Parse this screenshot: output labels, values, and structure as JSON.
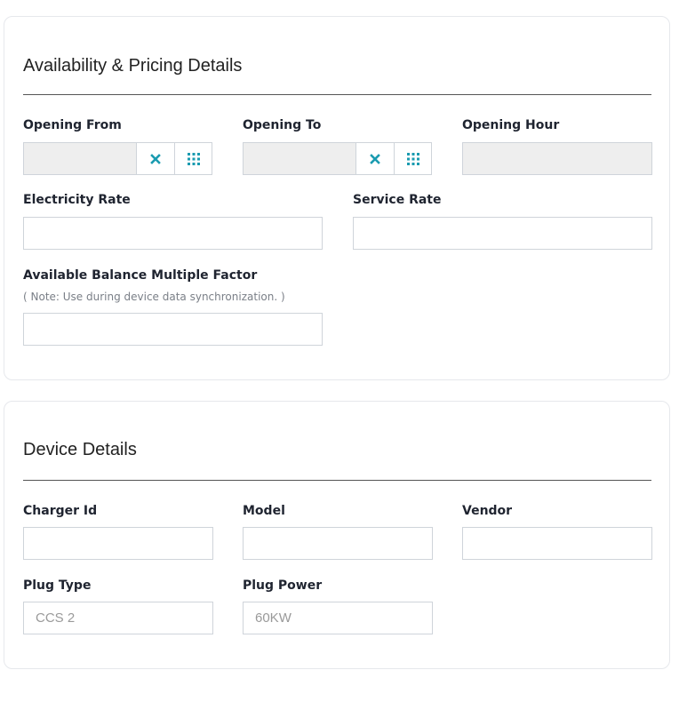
{
  "availability": {
    "title": "Availability & Pricing Details",
    "opening_from": {
      "label": "Opening From"
    },
    "opening_to": {
      "label": "Opening To"
    },
    "opening_hour": {
      "label": "Opening Hour"
    },
    "electricity_rate": {
      "label": "Electricity Rate"
    },
    "service_rate": {
      "label": "Service Rate"
    },
    "balance_factor": {
      "label": "Available Balance Multiple Factor",
      "note": "( Note: Use during device data synchronization. )"
    }
  },
  "device": {
    "title": "Device Details",
    "charger_id": {
      "label": "Charger Id"
    },
    "model": {
      "label": "Model"
    },
    "vendor": {
      "label": "Vendor"
    },
    "plug_type": {
      "label": "Plug Type",
      "placeholder": "CCS 2"
    },
    "plug_power": {
      "label": "Plug Power",
      "placeholder": "60KW"
    }
  },
  "icons": {
    "clear": "close-icon",
    "calendar": "calendar-grid-icon"
  },
  "colors": {
    "accent": "#1a9bb0"
  }
}
